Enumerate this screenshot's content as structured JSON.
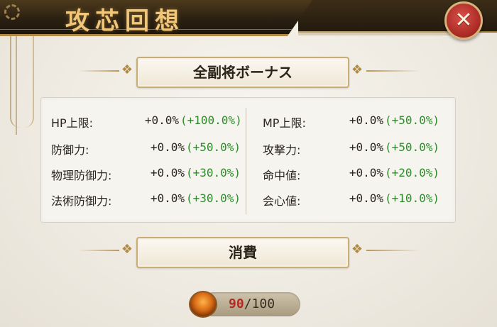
{
  "title": "攻芯回想",
  "close_icon": "close-x-icon",
  "section_bonus": {
    "title": "全副将ボーナス"
  },
  "section_cost": {
    "title": "消費"
  },
  "colors": {
    "bonus_green": "#2e8a2c",
    "cost_current": "#b32a24",
    "title_gold": "#f0c67a"
  },
  "stats_left": [
    {
      "label": "HP上限:",
      "value": "+0.0%",
      "bonus": "(+100.0%)"
    },
    {
      "label": "防御力:",
      "value": "+0.0%",
      "bonus": "(+50.0%)"
    },
    {
      "label": "物理防御力:",
      "value": "+0.0%",
      "bonus": "(+30.0%)"
    },
    {
      "label": "法術防御力:",
      "value": "+0.0%",
      "bonus": "(+30.0%)"
    }
  ],
  "stats_right": [
    {
      "label": "MP上限:",
      "value": "+0.0%",
      "bonus": "(+50.0%)"
    },
    {
      "label": "攻撃力:",
      "value": "+0.0%",
      "bonus": "(+50.0%)"
    },
    {
      "label": "命中値:",
      "value": "+0.0%",
      "bonus": "(+20.0%)"
    },
    {
      "label": "会心値:",
      "value": "+0.0%",
      "bonus": "(+10.0%)"
    }
  ],
  "cost": {
    "icon": "fire-orb-icon",
    "current": "90",
    "separator": "/",
    "max": "100"
  }
}
